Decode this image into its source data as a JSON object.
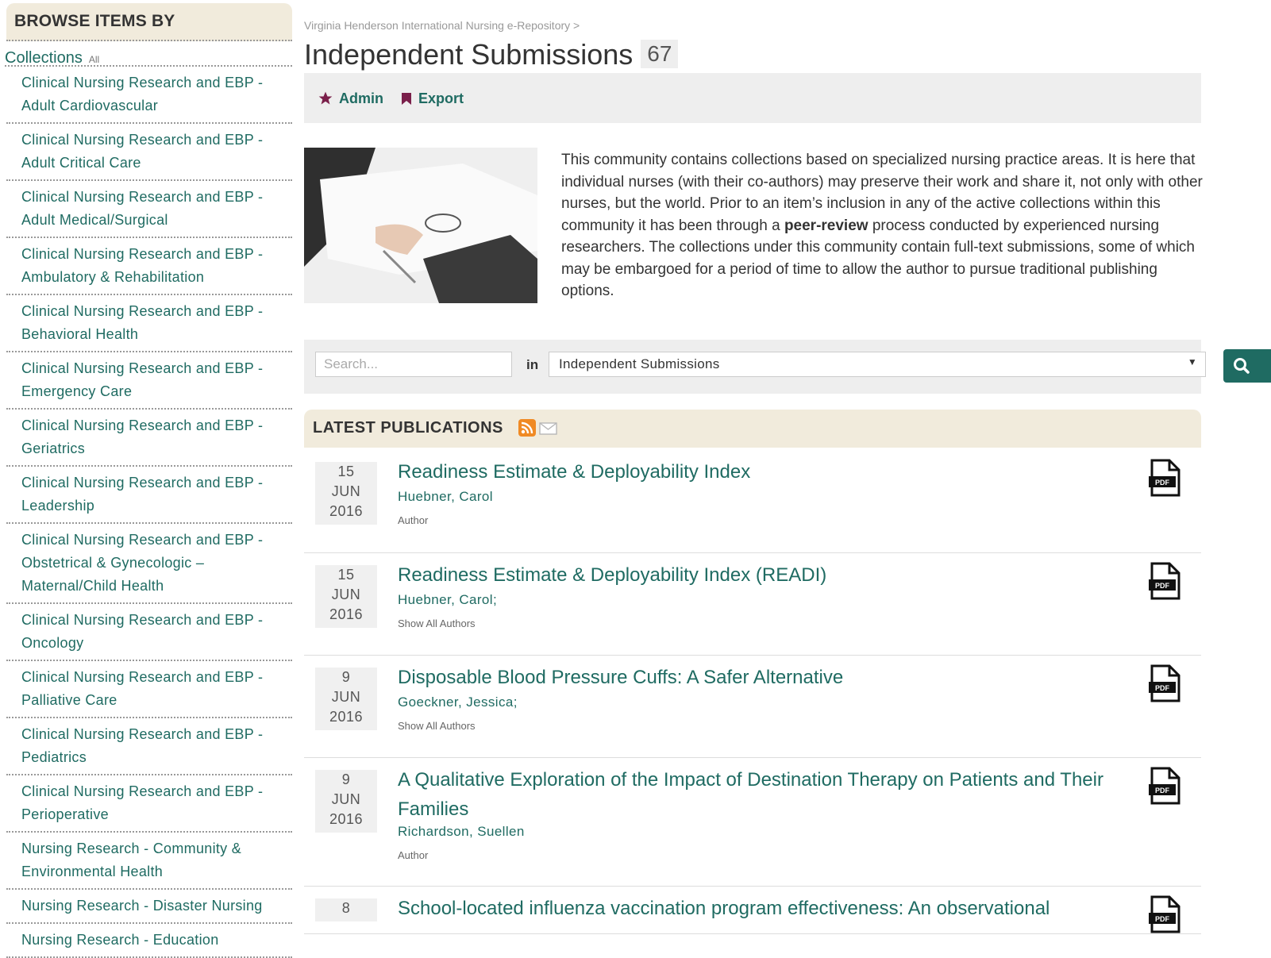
{
  "sidebar": {
    "heading": "BROWSE ITEMS BY",
    "collections_label": "Collections",
    "all_label": "All",
    "items": [
      [
        "Clinical Nursing Research and EBP -",
        "Adult Cardiovascular"
      ],
      [
        "Clinical Nursing Research and EBP -",
        "Adult Critical Care"
      ],
      [
        "Clinical Nursing Research and EBP -",
        "Adult Medical/Surgical"
      ],
      [
        "Clinical Nursing Research and EBP -",
        "Ambulatory & Rehabilitation"
      ],
      [
        "Clinical Nursing Research and EBP -",
        "Behavioral Health"
      ],
      [
        "Clinical Nursing Research and EBP -",
        "Emergency Care"
      ],
      [
        "Clinical Nursing Research and EBP -",
        "Geriatrics"
      ],
      [
        "Clinical Nursing Research and EBP -",
        "Leadership"
      ],
      [
        "Clinical Nursing Research and EBP -",
        "Obstetrical & Gynecologic –",
        "Maternal/Child Health"
      ],
      [
        "Clinical Nursing Research and EBP -",
        "Oncology"
      ],
      [
        "Clinical Nursing Research and EBP -",
        "Palliative Care"
      ],
      [
        "Clinical Nursing Research and EBP -",
        "Pediatrics"
      ],
      [
        "Clinical Nursing Research and EBP -",
        "Perioperative"
      ],
      [
        "Nursing Research - Community &",
        "Environmental Health"
      ],
      [
        "Nursing Research - Disaster Nursing"
      ],
      [
        "Nursing Research - Education"
      ]
    ]
  },
  "breadcrumb": "Virginia Henderson International Nursing e-Repository >",
  "page": {
    "title": "Independent Submissions",
    "count": "67"
  },
  "actions": {
    "admin": "Admin",
    "export": "Export"
  },
  "description": {
    "before_bold": "This community contains collections based on specialized nursing practice areas. It is here that individual nurses (with their co-authors) may preserve their work and share it, not only with other nurses, but the world. Prior to an item’s inclusion in any of the active collections within this community it has been through a ",
    "bold": "peer-review",
    "after_bold": " process conducted by experienced nursing researchers. The collections under this community contain full-text submissions, some of which may be embargoed for a period of time to allow the author to pursue traditional publishing options."
  },
  "search": {
    "placeholder": "Search...",
    "in_label": "in",
    "scope": "Independent Submissions"
  },
  "latest": {
    "heading": "LATEST PUBLICATIONS",
    "items": [
      {
        "day": "15",
        "month": "JUN",
        "year": "2016",
        "title": "Readiness Estimate & Deployability Index",
        "author": "Huebner, Carol",
        "role": "Author"
      },
      {
        "day": "15",
        "month": "JUN",
        "year": "2016",
        "title": "Readiness Estimate & Deployability Index (READI)",
        "author": "Huebner, Carol;",
        "role": "Show All Authors"
      },
      {
        "day": "9",
        "month": "JUN",
        "year": "2016",
        "title": "Disposable Blood Pressure Cuffs: A Safer Alternative",
        "author": "Goeckner, Jessica;",
        "role": "Show All Authors"
      },
      {
        "day": "9",
        "month": "JUN",
        "year": "2016",
        "title": "A Qualitative Exploration of the Impact of Destination Therapy on Patients and Their Families",
        "author": "Richardson, Suellen",
        "role": "Author"
      },
      {
        "day": "8",
        "month": "",
        "year": "",
        "title": "School-located influenza vaccination program effectiveness: An observational",
        "author": "",
        "role": ""
      }
    ]
  },
  "colors": {
    "accent": "#1f6b62",
    "panel": "#eeeeee",
    "header_bg": "#f1ebdc",
    "icon": "#7a1f4a"
  },
  "icons": {
    "admin": "star-icon",
    "export": "bookmark-icon",
    "rss": "rss-icon",
    "email": "email-icon",
    "pdf": "pdf-icon",
    "search": "search-icon"
  }
}
